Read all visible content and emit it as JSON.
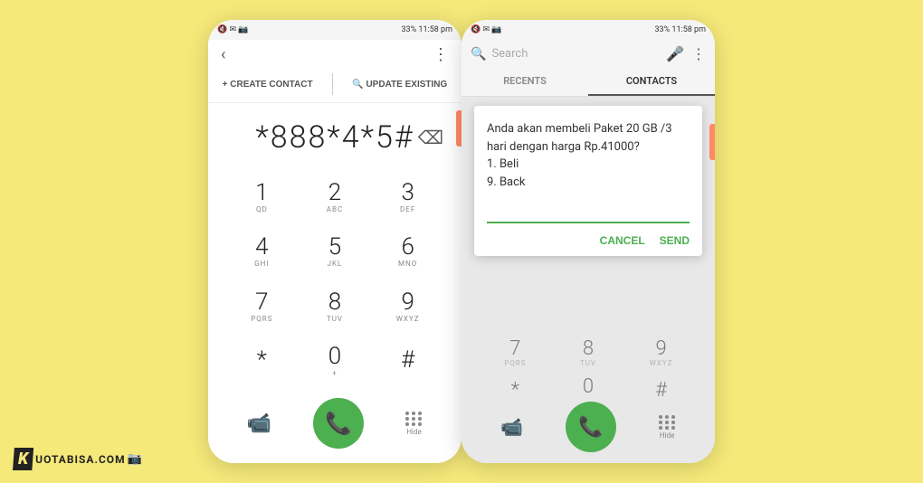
{
  "background": "#f5e97a",
  "phone1": {
    "statusBar": {
      "left": "🔇 ✉ 📷",
      "right": "33% 11:58 pm"
    },
    "backLabel": "‹",
    "moreLabel": "⋮",
    "actions": {
      "createLabel": "+ CREATE CONTACT",
      "updateLabel": "🔍 UPDATE EXISTING"
    },
    "dialNumber": "*888*4*5#",
    "backspaceIcon": "⌫",
    "keys": [
      {
        "num": "1",
        "sub": "QD"
      },
      {
        "num": "2",
        "sub": "ABC"
      },
      {
        "num": "3",
        "sub": "DEF"
      },
      {
        "num": "4",
        "sub": "GHI"
      },
      {
        "num": "5",
        "sub": "JKL"
      },
      {
        "num": "6",
        "sub": "MNO"
      },
      {
        "num": "7",
        "sub": "PQRS"
      },
      {
        "num": "8",
        "sub": "TUV"
      },
      {
        "num": "9",
        "sub": "WXYZ"
      },
      {
        "num": "*",
        "sub": ""
      },
      {
        "num": "0",
        "sub": "+"
      },
      {
        "num": "#",
        "sub": ""
      }
    ],
    "bottomBar": {
      "videoIcon": "📹",
      "callIcon": "📞",
      "hideLabel": "Hide"
    }
  },
  "phone2": {
    "statusBar": {
      "left": "🔇 ✉ 📷",
      "right": "33% 11:58 pm"
    },
    "searchPlaceholder": "Search",
    "micIcon": "🎤",
    "moreLabel": "⋮",
    "tabs": [
      {
        "label": "RECENTS",
        "active": false
      },
      {
        "label": "CONTACTS",
        "active": true
      }
    ],
    "dialog": {
      "message": "Anda akan membeli Paket 20 GB /3\nhari dengan harga Rp.41000?\n1. Beli\n9. Back",
      "inputPlaceholder": "",
      "cancelLabel": "CANCEL",
      "sendLabel": "SEND"
    },
    "keypadVisible": [
      {
        "num": "7",
        "sub": "PQRS"
      },
      {
        "num": "8",
        "sub": "TUV"
      },
      {
        "num": "9",
        "sub": "WXYZ"
      },
      {
        "num": "*",
        "sub": ""
      },
      {
        "num": "0",
        "sub": "+"
      },
      {
        "num": "#",
        "sub": ""
      }
    ],
    "bottomBar": {
      "videoIcon": "📹",
      "callIcon": "📞",
      "hideLabel": "Hide"
    }
  },
  "watermark": {
    "logoText": "K",
    "siteText": "UOTABISA.COM",
    "camIcon": "📷"
  }
}
